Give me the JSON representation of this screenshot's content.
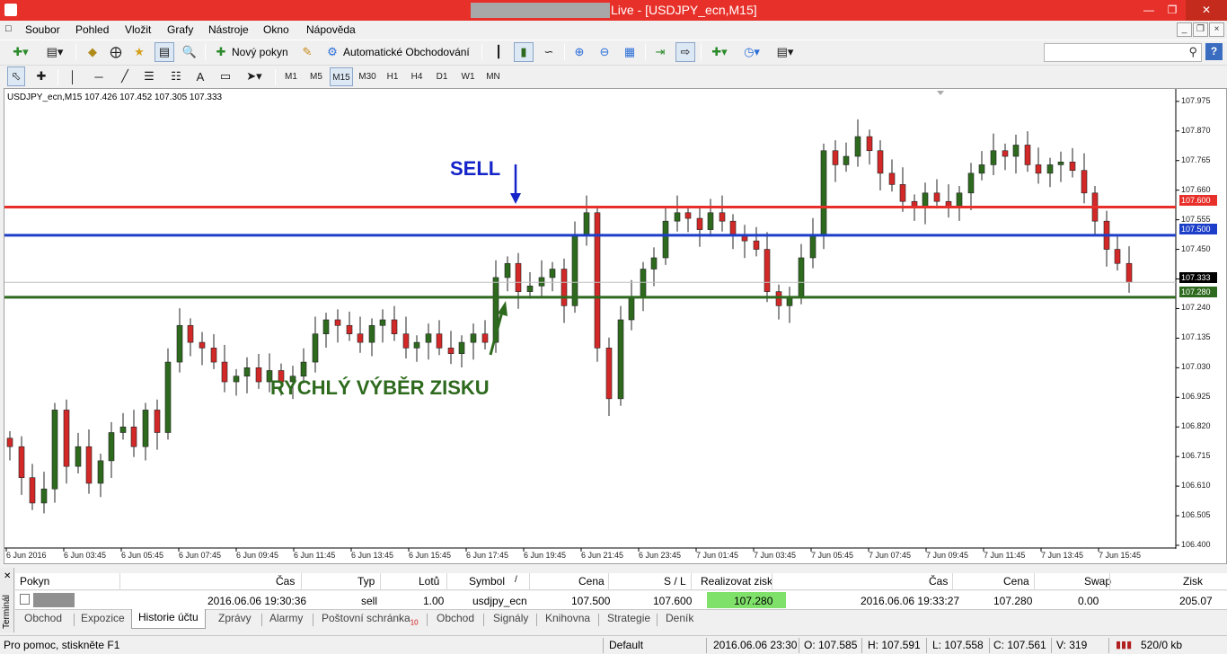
{
  "window": {
    "title": "Live - [USDJPY_ecn,M15]",
    "controls": [
      "—",
      "❐",
      "✕"
    ]
  },
  "menu": {
    "items": [
      "Soubor",
      "Pohled",
      "Vložit",
      "Grafy",
      "Nástroje",
      "Okno",
      "Nápověda"
    ],
    "mdi_controls": [
      "_",
      "❐",
      "×"
    ]
  },
  "toolbar": {
    "new_order": "Nový pokyn",
    "auto_trading": "Automatické Obchodování",
    "search_placeholder": "",
    "help_label": "?"
  },
  "timeframes": [
    "M1",
    "M5",
    "M15",
    "M30",
    "H1",
    "H4",
    "D1",
    "W1",
    "MN"
  ],
  "active_timeframe": "M15",
  "chart": {
    "header": "USDJPY_ecn,M15  107.426 107.452 107.305 107.333",
    "y_ticks": [
      "107.975",
      "107.870",
      "107.765",
      "107.660",
      "107.555",
      "107.450",
      "107.345",
      "107.240",
      "107.135",
      "107.030",
      "106.925",
      "106.820",
      "106.715",
      "106.610",
      "106.505",
      "106.400"
    ],
    "x_ticks": [
      "6 Jun 2016",
      "6 Jun 03:45",
      "6 Jun 05:45",
      "6 Jun 07:45",
      "6 Jun 09:45",
      "6 Jun 11:45",
      "6 Jun 13:45",
      "6 Jun 15:45",
      "6 Jun 17:45",
      "6 Jun 19:45",
      "6 Jun 21:45",
      "6 Jun 23:45",
      "7 Jun 01:45",
      "7 Jun 03:45",
      "7 Jun 05:45",
      "7 Jun 07:45",
      "7 Jun 09:45",
      "7 Jun 11:45",
      "7 Jun 13:45",
      "7 Jun 15:45"
    ],
    "price_labels": {
      "stop_loss": "107.600",
      "entry": "107.500",
      "current": "107.333",
      "take_profit": "107.280"
    },
    "annotations": {
      "sell": "SELL",
      "take_profit": "RYCHLÝ VÝBĚR ZISKU"
    },
    "colors": {
      "bull": "#2e6a1e",
      "bear": "#d22828",
      "stop_loss_line": "#e8302a",
      "entry_line": "#1c3ec8",
      "take_profit_line": "#2e6a1e",
      "sell_text": "#1424c8",
      "take_profit_text": "#2e6a1e"
    }
  },
  "chart_data": {
    "type": "candlestick",
    "symbol": "USDJPY_ecn",
    "timeframe": "M15",
    "ylim": [
      106.4,
      108.0
    ],
    "horizontal_lines": [
      {
        "label": "stop loss",
        "value": 107.6
      },
      {
        "label": "entry",
        "value": 107.5
      },
      {
        "label": "take profit",
        "value": 107.28
      }
    ],
    "closes": [
      106.75,
      106.64,
      106.55,
      106.6,
      106.88,
      106.68,
      106.75,
      106.62,
      106.7,
      106.8,
      106.82,
      106.75,
      106.88,
      106.8,
      107.05,
      107.18,
      107.12,
      107.1,
      107.05,
      106.98,
      107.0,
      107.03,
      106.98,
      107.02,
      106.98,
      107.0,
      107.05,
      107.15,
      107.2,
      107.18,
      107.15,
      107.12,
      107.18,
      107.2,
      107.15,
      107.1,
      107.12,
      107.15,
      107.1,
      107.08,
      107.12,
      107.15,
      107.12,
      107.35,
      107.4,
      107.3,
      107.32,
      107.35,
      107.38,
      107.25,
      107.5,
      107.58,
      107.1,
      106.92,
      107.2,
      107.28,
      107.38,
      107.42,
      107.55,
      107.58,
      107.56,
      107.52,
      107.58,
      107.55,
      107.5,
      107.48,
      107.45,
      107.3,
      107.25,
      107.28,
      107.42,
      107.5,
      107.8,
      107.75,
      107.78,
      107.85,
      107.8,
      107.72,
      107.68,
      107.62,
      107.6,
      107.65,
      107.62,
      107.6,
      107.65,
      107.72,
      107.75,
      107.8,
      107.78,
      107.82,
      107.75,
      107.72,
      107.75,
      107.76,
      107.73,
      107.65,
      107.55,
      107.45,
      107.4,
      107.333
    ]
  },
  "terminal": {
    "side_label": "Terminál",
    "columns": [
      "Pokyn",
      "Čas",
      "Typ",
      "Lotů",
      "Symbol",
      "Cena",
      "S / L",
      "Realizovat zisk",
      "Čas",
      "Cena",
      "Swap",
      "Zisk"
    ],
    "sort_marker": "/",
    "rows": [
      {
        "time": "2016.06.06 19:30:36",
        "type": "sell",
        "lots": "1.00",
        "symbol": "usdjpy_ecn",
        "price": "107.500",
        "sl": "107.600",
        "tp": "107.280",
        "close_time": "2016.06.06 19:33:27",
        "close_price": "107.280",
        "swap": "0.00",
        "profit": "205.07"
      }
    ],
    "tabs": [
      "Obchod",
      "Expozice",
      "Historie účtu",
      "Zprávy",
      "Alarmy",
      "Poštovní schránka",
      "Obchod",
      "Signály",
      "Knihovna",
      "Strategie",
      "Deník"
    ],
    "mailbox_badge": "10",
    "active_tab": "Historie účtu"
  },
  "status": {
    "help": "Pro pomoc, stiskněte F1",
    "profile": "Default",
    "datetime": "2016.06.06 23:30",
    "open": "O: 107.585",
    "high": "H: 107.591",
    "low": "L: 107.558",
    "close": "C: 107.561",
    "volume": "V: 319",
    "traffic": "520/0 kb"
  }
}
